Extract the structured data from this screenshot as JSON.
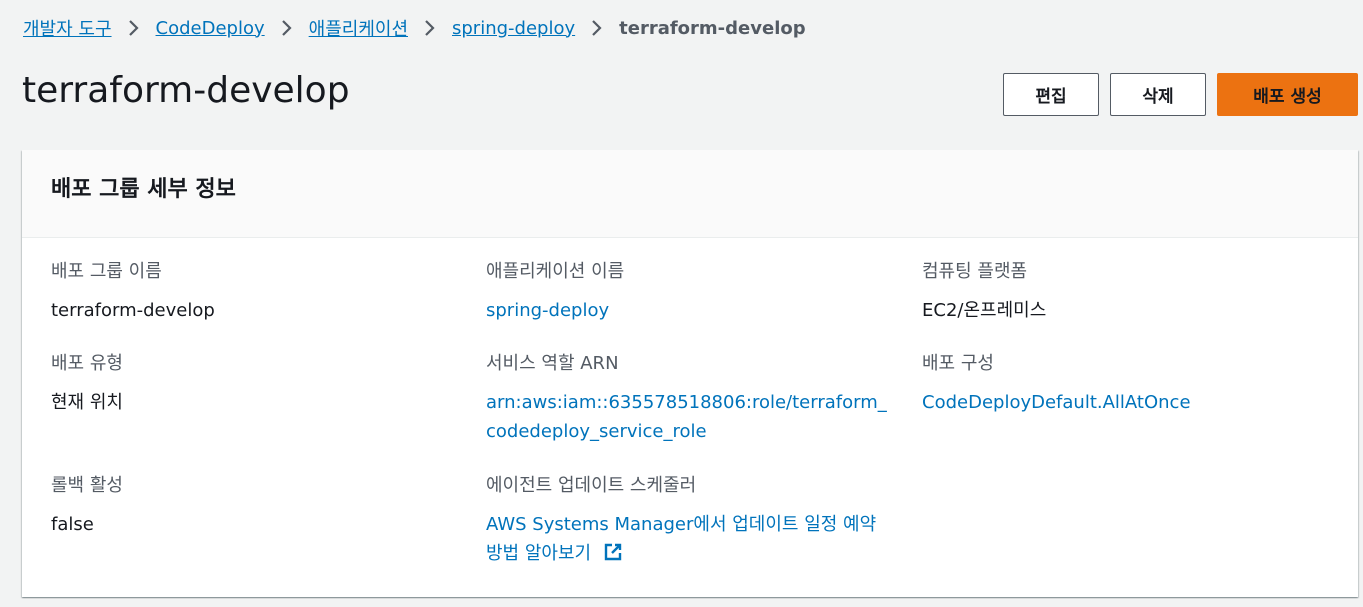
{
  "breadcrumb": [
    {
      "label": "개발자 도구",
      "link": true
    },
    {
      "label": "CodeDeploy",
      "link": true
    },
    {
      "label": "애플리케이션",
      "link": true
    },
    {
      "label": "spring-deploy",
      "link": true
    },
    {
      "label": "terraform-develop",
      "link": false
    }
  ],
  "page": {
    "title": "terraform-develop"
  },
  "actions": {
    "edit_label": "편집",
    "delete_label": "삭제",
    "create_deployment_label": "배포 생성"
  },
  "panel": {
    "title": "배포 그룹 세부 정보",
    "fields": {
      "group_name": {
        "label": "배포 그룹 이름",
        "value": "terraform-develop"
      },
      "app_name": {
        "label": "애플리케이션 이름",
        "value": "spring-deploy"
      },
      "compute_platform": {
        "label": "컴퓨팅 플랫폼",
        "value": "EC2/온프레미스"
      },
      "deployment_type": {
        "label": "배포 유형",
        "value": "현재 위치"
      },
      "service_role_arn": {
        "label": "서비스 역할 ARN",
        "value": "arn:aws:iam::635578518806:role/terraform_codedeploy_service_role"
      },
      "deployment_config": {
        "label": "배포 구성",
        "value": "CodeDeployDefault.AllAtOnce"
      },
      "rollback_enabled": {
        "label": "롤백 활성",
        "value": "false"
      },
      "agent_scheduler": {
        "label": "에이전트 업데이트 스케줄러",
        "value": "AWS Systems Manager에서 업데이트 일정 예약 방법 알아보기"
      }
    }
  },
  "icons": {
    "chevron": "chevron-right-icon",
    "external": "external-link-icon"
  },
  "colors": {
    "link": "#0073bb",
    "primary": "#ec7211",
    "page_bg": "#f2f3f3"
  }
}
